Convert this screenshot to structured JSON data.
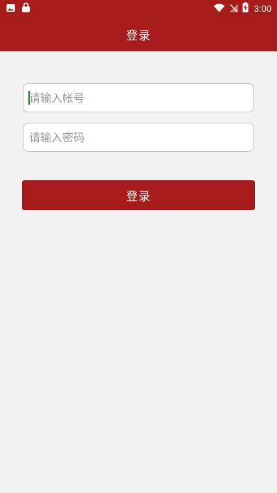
{
  "status_bar": {
    "time": "3:00",
    "left_icons": [
      "image-icon",
      "lock-icon"
    ],
    "right_icons": [
      "wifi-icon",
      "no-signal-icon",
      "battery-charging-icon"
    ]
  },
  "header": {
    "title": "登录"
  },
  "form": {
    "account_placeholder": "请输入帐号",
    "password_placeholder": "请输入密码",
    "login_label": "登录"
  },
  "colors": {
    "brand": "#a81b1b",
    "background": "#f2f2f2",
    "field_border": "#c4c4c4"
  }
}
